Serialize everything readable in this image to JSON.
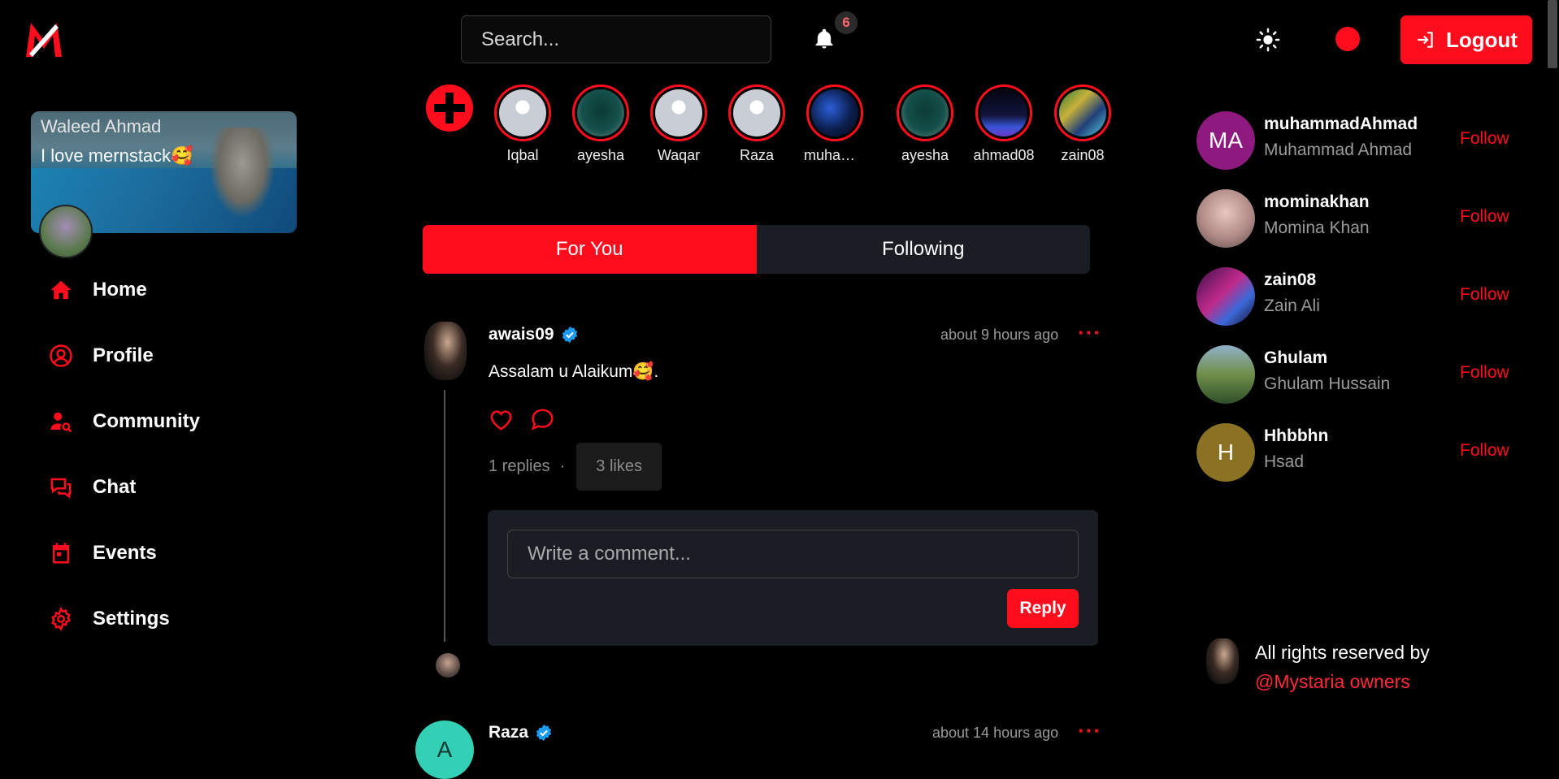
{
  "header": {
    "search_placeholder": "Search...",
    "notification_count": "6",
    "logout_label": "Logout"
  },
  "profile_card": {
    "name": "Waleed Ahmad",
    "bio": "I love mernstack🥰"
  },
  "nav": {
    "items": [
      {
        "label": "Home",
        "icon": "home-icon"
      },
      {
        "label": "Profile",
        "icon": "user-circle-icon"
      },
      {
        "label": "Community",
        "icon": "user-search-icon"
      },
      {
        "label": "Chat",
        "icon": "chat-bubbles-icon"
      },
      {
        "label": "Events",
        "icon": "calendar-icon"
      },
      {
        "label": "Settings",
        "icon": "gear-icon"
      }
    ]
  },
  "stories": {
    "items": [
      {
        "label": "Iqbal"
      },
      {
        "label": "ayesha"
      },
      {
        "label": "Waqar"
      },
      {
        "label": "Raza"
      },
      {
        "label": "muhamm..."
      },
      {
        "label": "ayesha"
      },
      {
        "label": "ahmad08"
      },
      {
        "label": "zain08"
      }
    ]
  },
  "tabs": {
    "for_you": "For You",
    "following": "Following"
  },
  "posts": {
    "first": {
      "username": "awais09",
      "time": "about 9 hours ago",
      "text": "Assalam u Alaikum🥰.",
      "replies": "1 replies",
      "separator": "·",
      "likes": "3 likes",
      "comment_placeholder": "Write a comment...",
      "reply_label": "Reply"
    },
    "second": {
      "username": "Raza",
      "avatar_letter": "A",
      "time": "about 14 hours ago"
    }
  },
  "suggestions": {
    "follow_label": "Follow",
    "items": [
      {
        "username": "muhammadAhmad",
        "name": "Muhammad Ahmad",
        "initials": "MA",
        "color": "#8e1a80"
      },
      {
        "username": "mominakhan",
        "name": "Momina Khan",
        "initials": "",
        "color": "#c9a6a8"
      },
      {
        "username": "zain08",
        "name": "Zain Ali",
        "initials": "",
        "color": "#6a1a6a"
      },
      {
        "username": "Ghulam",
        "name": "Ghulam Hussain",
        "initials": "",
        "color": "#6f8f4a"
      },
      {
        "username": "Hhbbhn",
        "name": "Hsad",
        "initials": "H",
        "color": "#8a7124"
      }
    ]
  },
  "footer": {
    "rights": "All rights reserved by",
    "owner": "@Mystaria owners"
  },
  "colors": {
    "accent": "#ff0d1d",
    "panel": "#1b1d24",
    "background": "#000000",
    "verified": "#1d9bf0"
  }
}
